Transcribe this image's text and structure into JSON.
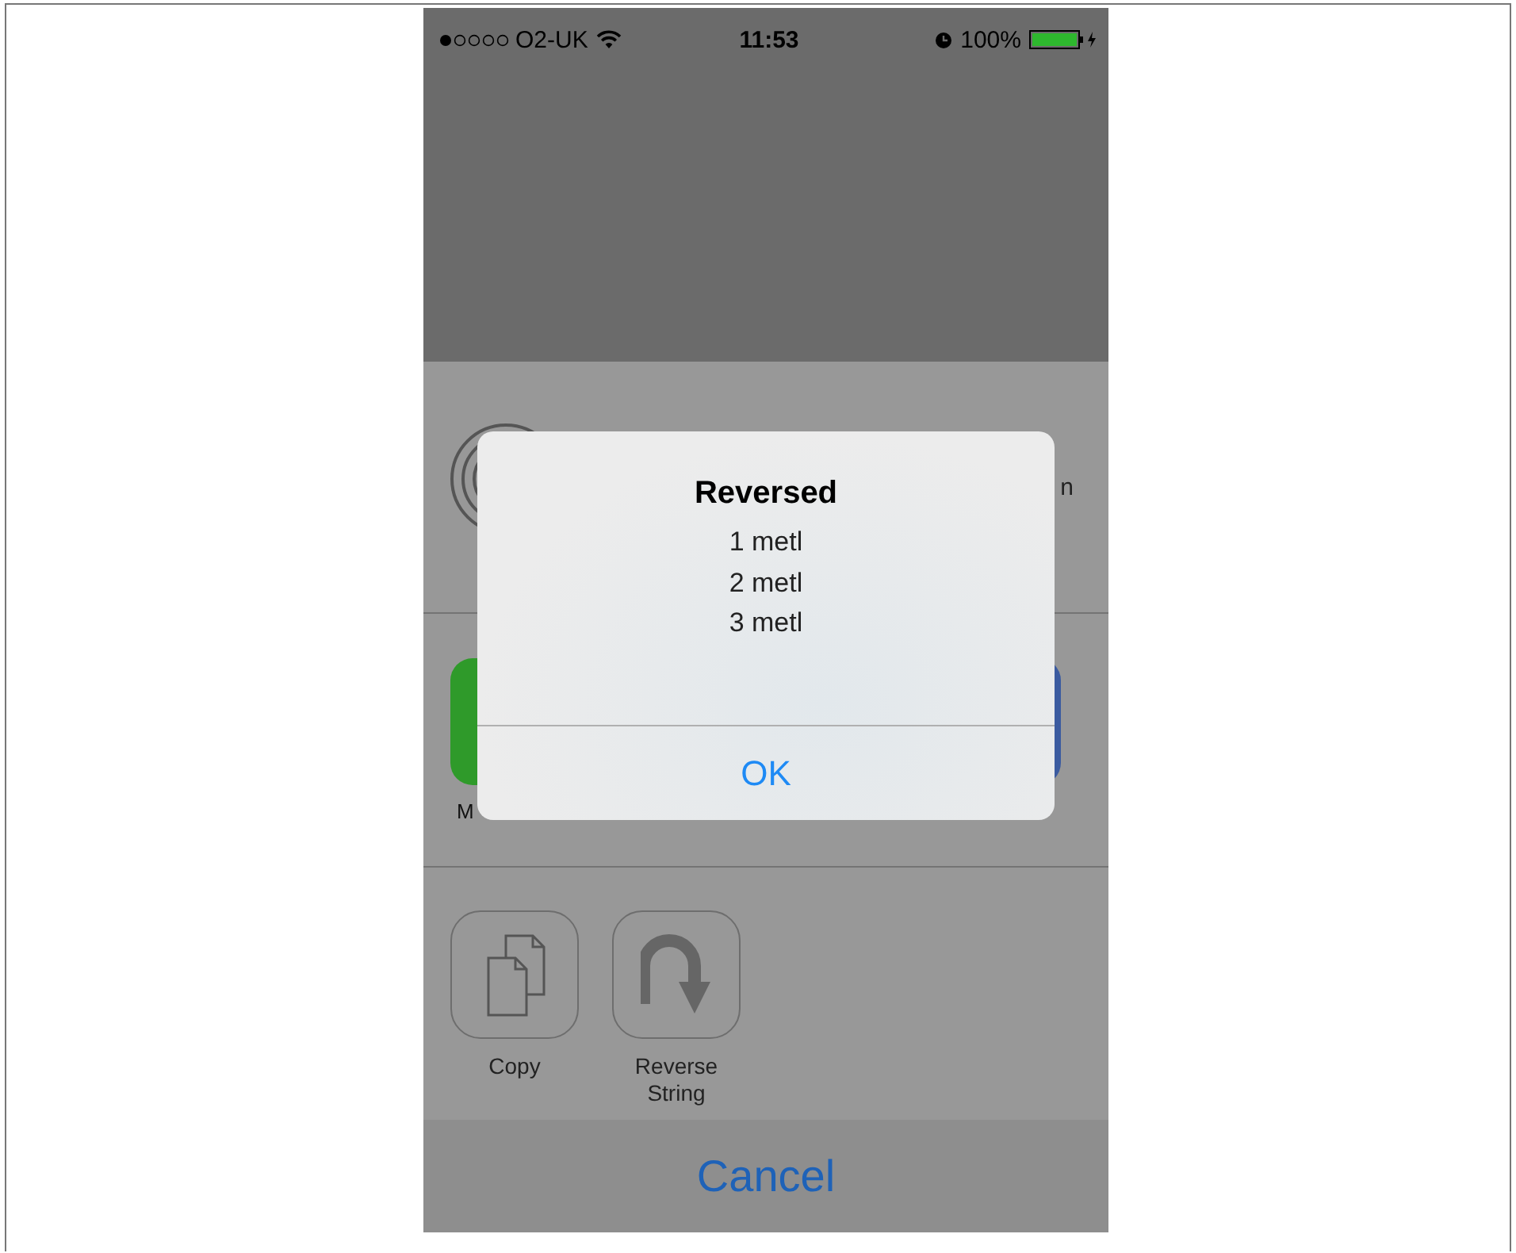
{
  "status_bar": {
    "carrier": "O2-UK",
    "time": "11:53",
    "battery": "100%"
  },
  "airdrop": {
    "text_fragment": "n"
  },
  "share_apps": [
    {
      "color": "#2f9a2a",
      "label_fragment": "M"
    },
    {
      "color": "#3b5ba0"
    }
  ],
  "actions": [
    {
      "kind": "copy",
      "label": "Copy"
    },
    {
      "kind": "reverse",
      "label": "Reverse String"
    }
  ],
  "alert": {
    "title": "Reversed",
    "lines": [
      "1 metl",
      "2 metl",
      "3 metl"
    ],
    "button": "OK"
  },
  "cancel": "Cancel"
}
